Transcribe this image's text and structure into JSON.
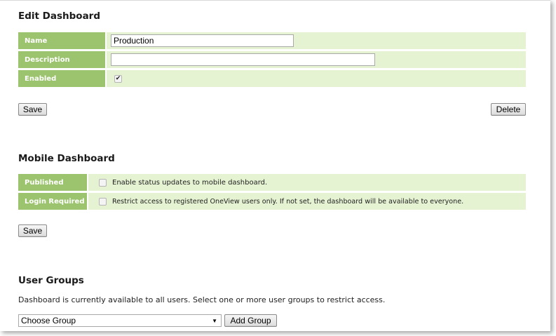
{
  "edit_dashboard": {
    "title": "Edit Dashboard",
    "name_label": "Name",
    "name_value": "Production",
    "description_label": "Description",
    "description_value": "",
    "enabled_label": "Enabled",
    "enabled_checked": true,
    "save_label": "Save",
    "delete_label": "Delete"
  },
  "mobile_dashboard": {
    "title": "Mobile Dashboard",
    "published_label": "Published",
    "published_text": "Enable status updates to mobile dashboard.",
    "login_label": "Login Required",
    "login_text": "Restrict access to registered OneView users only. If not set, the dashboard will be available to everyone.",
    "save_label": "Save"
  },
  "user_groups": {
    "title": "User Groups",
    "description": "Dashboard is currently available to all users. Select one or more user groups to restrict access.",
    "select_value": "Choose Group",
    "add_label": "Add Group"
  },
  "colors": {
    "label_bg": "#9cc46e",
    "value_bg": "#e6f3d3"
  },
  "icons": {
    "checkmark": "check-icon",
    "dropdown": "chevron-down-icon"
  }
}
